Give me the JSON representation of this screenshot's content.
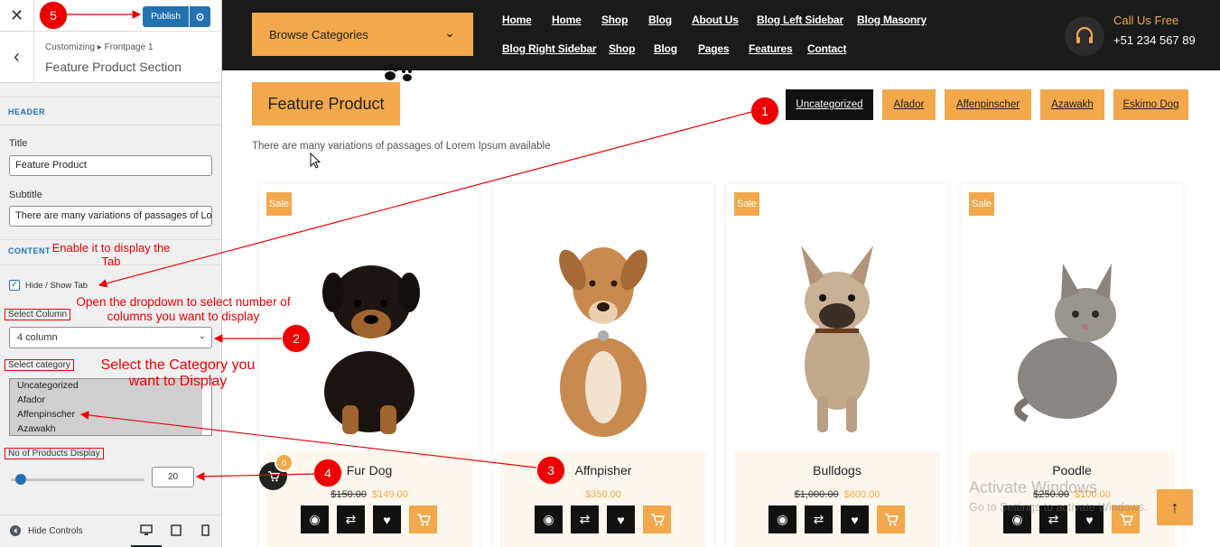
{
  "customizer": {
    "close_icon": "✕",
    "publish_label": "Publish",
    "gear_icon": "⚙",
    "back_icon": "‹",
    "breadcrumb": "Customizing ▸ Frontpage 1",
    "section_title": "Feature Product Section",
    "header_section": "HEADER",
    "title_label": "Title",
    "title_value": "Feature Product",
    "subtitle_label": "Subtitle",
    "subtitle_value": "There are many variations of passages of Lo",
    "content_section": "CONTENT",
    "hide_show_label": "Hide / Show Tab",
    "checkbox_mark": "✓",
    "select_column_label": "Select Column",
    "column_value": "4 column",
    "chevron": "⌄",
    "select_category_label": "Select category",
    "categories": [
      "Uncategorized",
      "Afador",
      "Affenpinscher",
      "Azawakh"
    ],
    "products_label": "No of Products Display",
    "products_count": "20",
    "slider_value_fraction": 0.05,
    "hide_controls_label": "Hide Controls"
  },
  "site": {
    "browse_categories": "Browse Categories",
    "nav_row1": [
      "Home",
      "Home",
      "Shop",
      "Blog",
      "About Us",
      "Blog Left Sidebar",
      "Blog Masonry"
    ],
    "nav_row2": [
      "Blog Right Sidebar",
      "Shop",
      "Blog",
      "Pages",
      "Features",
      "Contact"
    ],
    "call_title": "Call Us Free",
    "call_phone": "+51 234 567 89",
    "section_title": "Feature Product",
    "section_subtitle": "There are many variations of passages of Lorem Ipsum available",
    "tabs": [
      "Uncategorized",
      "Afador",
      "Affenpinscher",
      "Azawakh",
      "Eskimo Dog"
    ],
    "sale_label": "Sale",
    "products": [
      {
        "name": "Fur Dog",
        "old_price": "$150.00",
        "price": "$149.00"
      },
      {
        "name": "Affnpisher",
        "old_price": "",
        "price": "$350.00"
      },
      {
        "name": "Bulldogs",
        "old_price": "$1,000.00",
        "price": "$800.00"
      },
      {
        "name": "Poodle",
        "old_price": "$250.00",
        "price": "$100.00"
      }
    ],
    "cart_badge": "0",
    "scroll_top_icon": "↑",
    "watermark_title": "Activate Windows",
    "watermark_sub": "Go to Settings to activate Windows."
  },
  "annotations": {
    "badges": [
      "1",
      "2",
      "3",
      "4",
      "5"
    ],
    "note_tab": "Enable it to display the Tab",
    "note_columns": "Open the dropdown to select number of columns you want to display",
    "note_category": "Select the Category you want to Display"
  },
  "colors": {
    "accent": "#f2a84b",
    "dark": "#1a1a1a",
    "wp_blue": "#2271b1",
    "annotation_red": "#e00000"
  }
}
